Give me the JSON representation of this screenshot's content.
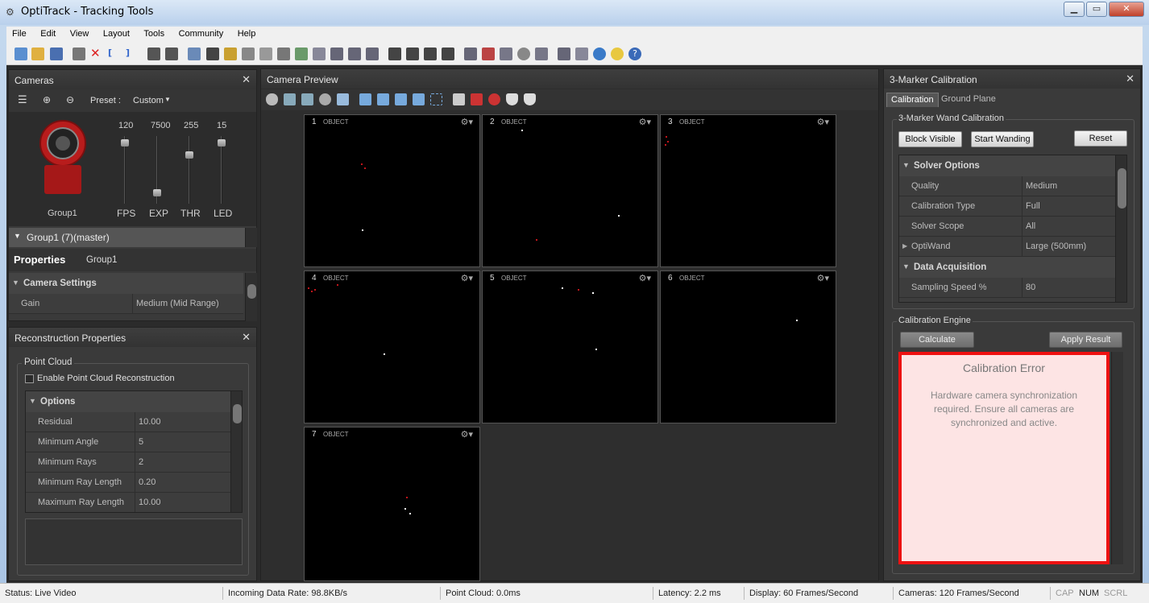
{
  "window": {
    "title": "OptiTrack - Tracking Tools"
  },
  "menu": [
    "File",
    "Edit",
    "View",
    "Layout",
    "Tools",
    "Community",
    "Help"
  ],
  "cameras_panel": {
    "title": "Cameras",
    "preset_label": "Preset :",
    "preset_value": "Custom",
    "group_label": "Group1",
    "sliders": [
      {
        "name": "FPS",
        "value": "120",
        "level": 0.95
      },
      {
        "name": "EXP",
        "value": "7500",
        "level": 0.12
      },
      {
        "name": "THR",
        "value": "255",
        "level": 0.75
      },
      {
        "name": "LED",
        "value": "15",
        "level": 0.95
      }
    ],
    "tree_group": "Group1 (7)(master)",
    "properties_title": "Properties",
    "properties_sub": "Group1",
    "camera_settings": "Camera Settings",
    "gain_label": "Gain",
    "gain_value": "Medium (Mid Range)"
  },
  "recon_panel": {
    "title": "Reconstruction Properties",
    "point_cloud": "Point Cloud",
    "enable_label": "Enable Point Cloud Reconstruction",
    "options_label": "Options",
    "rows": [
      {
        "k": "Residual",
        "v": "10.00"
      },
      {
        "k": "Minimum Angle",
        "v": "5"
      },
      {
        "k": "Minimum Rays",
        "v": "2"
      },
      {
        "k": "Minimum Ray Length",
        "v": "0.20"
      },
      {
        "k": "Maximum Ray Length",
        "v": "10.00"
      }
    ]
  },
  "preview_panel": {
    "title": "Camera Preview",
    "cameras": [
      {
        "num": "1",
        "mode": "OBJECT"
      },
      {
        "num": "2",
        "mode": "OBJECT"
      },
      {
        "num": "3",
        "mode": "OBJECT"
      },
      {
        "num": "4",
        "mode": "OBJECT"
      },
      {
        "num": "5",
        "mode": "OBJECT"
      },
      {
        "num": "6",
        "mode": "OBJECT"
      },
      {
        "num": "7",
        "mode": "OBJECT"
      }
    ]
  },
  "calib_panel": {
    "title": "3-Marker Calibration",
    "tab_calibration": "Calibration",
    "tab_ground": "Ground Plane",
    "wand_group": "3-Marker Wand Calibration",
    "block_visible": "Block Visible",
    "start_wanding": "Start Wanding",
    "reset": "Reset",
    "solver_options": "Solver Options",
    "solver_rows": [
      {
        "k": "Quality",
        "v": "Medium"
      },
      {
        "k": "Calibration Type",
        "v": "Full"
      },
      {
        "k": "Solver Scope",
        "v": "All"
      },
      {
        "k": "OptiWand",
        "v": "Large (500mm)"
      }
    ],
    "data_acq": "Data Acquisition",
    "sampling_k": "Sampling Speed %",
    "sampling_v": "80",
    "engine_group": "Calibration Engine",
    "calculate": "Calculate",
    "apply_result": "Apply Result",
    "error_title": "Calibration Error",
    "error_msg": "Hardware camera synchronization required. Ensure all cameras are synchronized and active."
  },
  "status": {
    "status": "Status: Live Video",
    "incoming": "Incoming Data Rate: 98.8KB/s",
    "point_cloud": "Point Cloud: 0.0ms",
    "latency": "Latency: 2.2 ms",
    "display": "Display: 60 Frames/Second",
    "cameras": "Cameras: 120 Frames/Second",
    "cap": "CAP",
    "num": "NUM",
    "scrl": "SCRL"
  },
  "colors": {
    "accent": "#c0151b",
    "panel": "#3a3a3a",
    "error_bg": "#fde4e4",
    "error_border": "#ee1111"
  }
}
